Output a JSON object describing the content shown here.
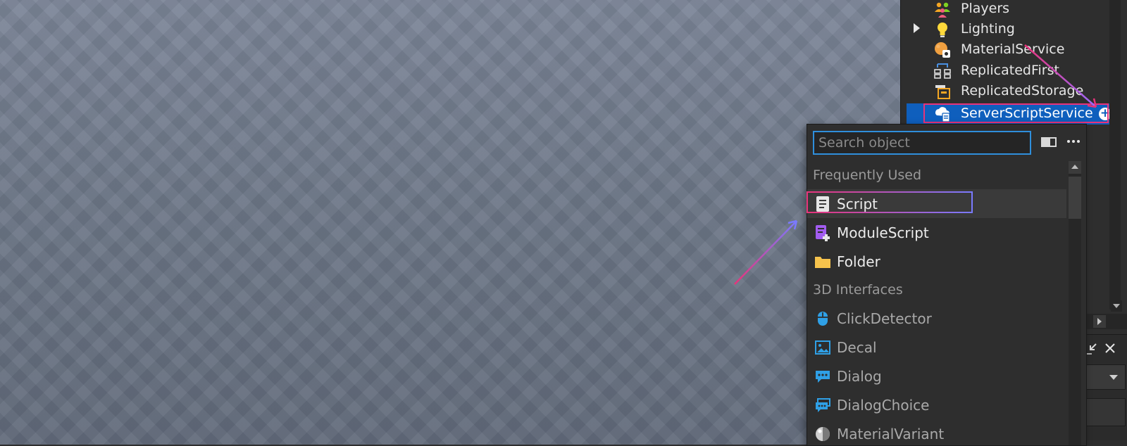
{
  "explorer": {
    "items": [
      {
        "label": "Players",
        "icon": "players-icon",
        "expandable": false
      },
      {
        "label": "Lighting",
        "icon": "lightbulb-icon",
        "expandable": true
      },
      {
        "label": "MaterialService",
        "icon": "material-service-icon",
        "expandable": false
      },
      {
        "label": "ReplicatedFirst",
        "icon": "replicated-first-icon",
        "expandable": false
      },
      {
        "label": "ReplicatedStorage",
        "icon": "replicated-storage-icon",
        "expandable": false
      },
      {
        "label": "ServerScriptService",
        "icon": "server-script-service-icon",
        "expandable": false,
        "selected": true
      }
    ],
    "selected_accent": "#0f5fbd"
  },
  "insert_popup": {
    "search_placeholder": "Search object",
    "sections": [
      {
        "title": "Frequently Used",
        "items": [
          {
            "label": "Script",
            "icon": "script-icon",
            "hovered": true
          },
          {
            "label": "ModuleScript",
            "icon": "module-script-icon"
          },
          {
            "label": "Folder",
            "icon": "folder-icon"
          }
        ]
      },
      {
        "title": "3D Interfaces",
        "items": [
          {
            "label": "ClickDetector",
            "icon": "click-detector-icon"
          },
          {
            "label": "Decal",
            "icon": "decal-icon"
          },
          {
            "label": "Dialog",
            "icon": "dialog-icon"
          },
          {
            "label": "DialogChoice",
            "icon": "dialog-choice-icon"
          },
          {
            "label": "MaterialVariant",
            "icon": "material-variant-icon"
          }
        ]
      }
    ]
  },
  "annotation_colors": {
    "pink": "#e8337a",
    "violet": "#7a7aff"
  }
}
